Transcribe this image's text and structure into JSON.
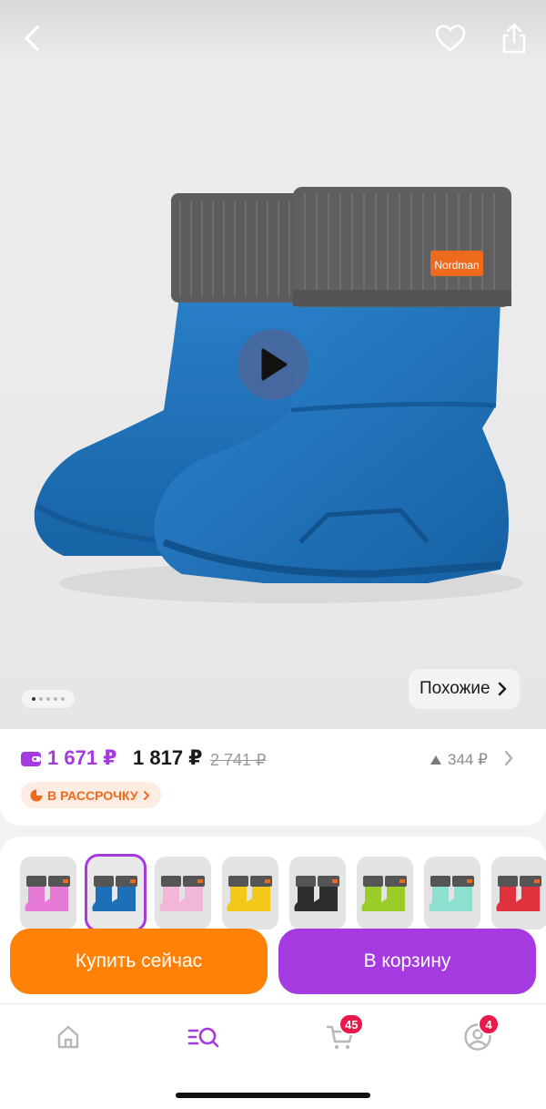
{
  "header": {
    "back_icon": "chevron-left-icon",
    "favorite_icon": "heart-icon",
    "share_icon": "share-icon"
  },
  "gallery": {
    "brand_tag": "Nordman",
    "boot_color": "#1d6fb8",
    "cuff_color": "#5f5f5f",
    "total_slides": 5,
    "active_slide": 1,
    "similar_label": "Похожие"
  },
  "price": {
    "wallet_price": "1 671 ₽",
    "regular_price": "1 817 ₽",
    "old_price": "2 741 ₽",
    "delta": "344 ₽",
    "installment_label": "В РАССРОЧКУ",
    "accent": "#a43ae0",
    "installment_color": "#ef6a1e"
  },
  "variants": [
    {
      "name": "pink",
      "color": "#e77ad6"
    },
    {
      "name": "blue",
      "color": "#1d6fb8"
    },
    {
      "name": "light-pink",
      "color": "#f1b6d8"
    },
    {
      "name": "yellow",
      "color": "#f2c91b"
    },
    {
      "name": "black",
      "color": "#2d2d2d"
    },
    {
      "name": "lime",
      "color": "#9acd2a"
    },
    {
      "name": "mint",
      "color": "#8de0cf"
    },
    {
      "name": "red",
      "color": "#e0313f"
    }
  ],
  "selected_variant": 1,
  "actions": {
    "buy_now": "Купить сейчас",
    "add_to_cart": "В корзину",
    "buy_color": "#ff8108",
    "cart_color": "#a43ae0"
  },
  "tabbar": {
    "home_icon": "home-icon",
    "catalog_icon": "catalog-search-icon",
    "cart_icon": "cart-icon",
    "cart_badge": "45",
    "profile_icon": "profile-icon",
    "profile_badge": "4"
  }
}
